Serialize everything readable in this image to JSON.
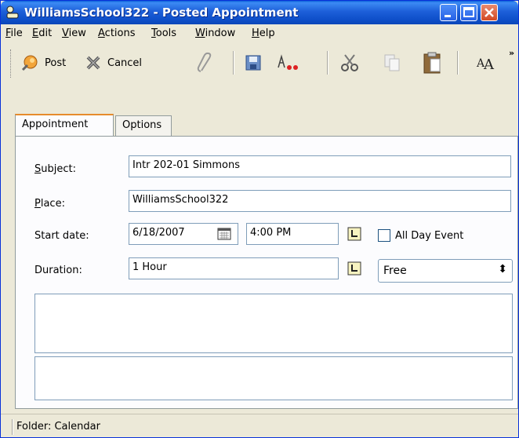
{
  "window": {
    "title": "WilliamsSchool322 - Posted Appointment"
  },
  "menu": {
    "items": [
      {
        "label": "File",
        "underline": "F",
        "rest": "ile"
      },
      {
        "label": "Edit",
        "underline": "E",
        "rest": "dit"
      },
      {
        "label": "View",
        "underline": "V",
        "rest": "iew"
      },
      {
        "label": "Actions",
        "underline": "A",
        "rest": "ctions"
      },
      {
        "label": "Tools",
        "underline": "T",
        "rest": "ools"
      },
      {
        "label": "Window",
        "underline": "W",
        "rest": "indow"
      },
      {
        "label": "Help",
        "underline": "H",
        "rest": "elp"
      }
    ]
  },
  "toolbar": {
    "post_label": "Post",
    "cancel_label": "Cancel",
    "overflow": "»"
  },
  "tabs": {
    "appointment": "Appointment",
    "options": "Options"
  },
  "form": {
    "subject_label_u": "S",
    "subject_label_rest": "ubject:",
    "subject_value": "Intr 202-01 Simmons",
    "place_label_u": "P",
    "place_label_rest": "lace:",
    "place_value": "WilliamsSchool322",
    "start_date_label": "Start date:",
    "start_date_value": "6/18/2007",
    "start_time_value": "4:00 PM",
    "all_day_label": "All Day Event",
    "all_day_checked": false,
    "duration_label": "Duration:",
    "duration_value": "1 Hour",
    "show_as_value": "Free"
  },
  "status": {
    "text": "Folder: Calendar"
  },
  "colors": {
    "title_bar": "#0a5fd8",
    "active_tab_accent": "#e68b2c"
  }
}
